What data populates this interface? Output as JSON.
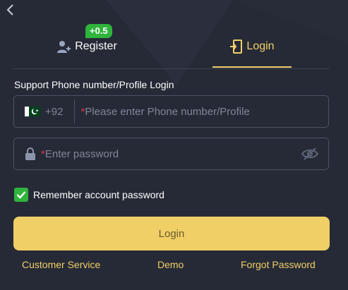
{
  "tabs": {
    "register_label": "Register",
    "register_badge": "+0.5",
    "login_label": "Login"
  },
  "form": {
    "section_label": "Support Phone number/Profile Login",
    "country_code": "+92",
    "required_mark": "*",
    "phone_placeholder": "Please enter Phone number/Profile",
    "password_placeholder": "Enter password",
    "remember_label": "Remember account password",
    "remember_checked": true
  },
  "login_button": "Login",
  "links": {
    "customer_service": "Customer Service",
    "demo": "Demo",
    "forgot_password": "Forgot Password"
  },
  "icons": {
    "back": "chevron-left-icon",
    "register": "user-plus-icon",
    "login": "door-enter-icon",
    "flag": "pakistan-flag-icon",
    "lock": "lock-icon",
    "eye": "eye-off-icon",
    "check": "check-icon"
  },
  "colors": {
    "background": "#262a36",
    "accent": "#f0cf67",
    "badge": "#2fb43c",
    "required": "#e0344a",
    "field_border": "#4c5366"
  }
}
